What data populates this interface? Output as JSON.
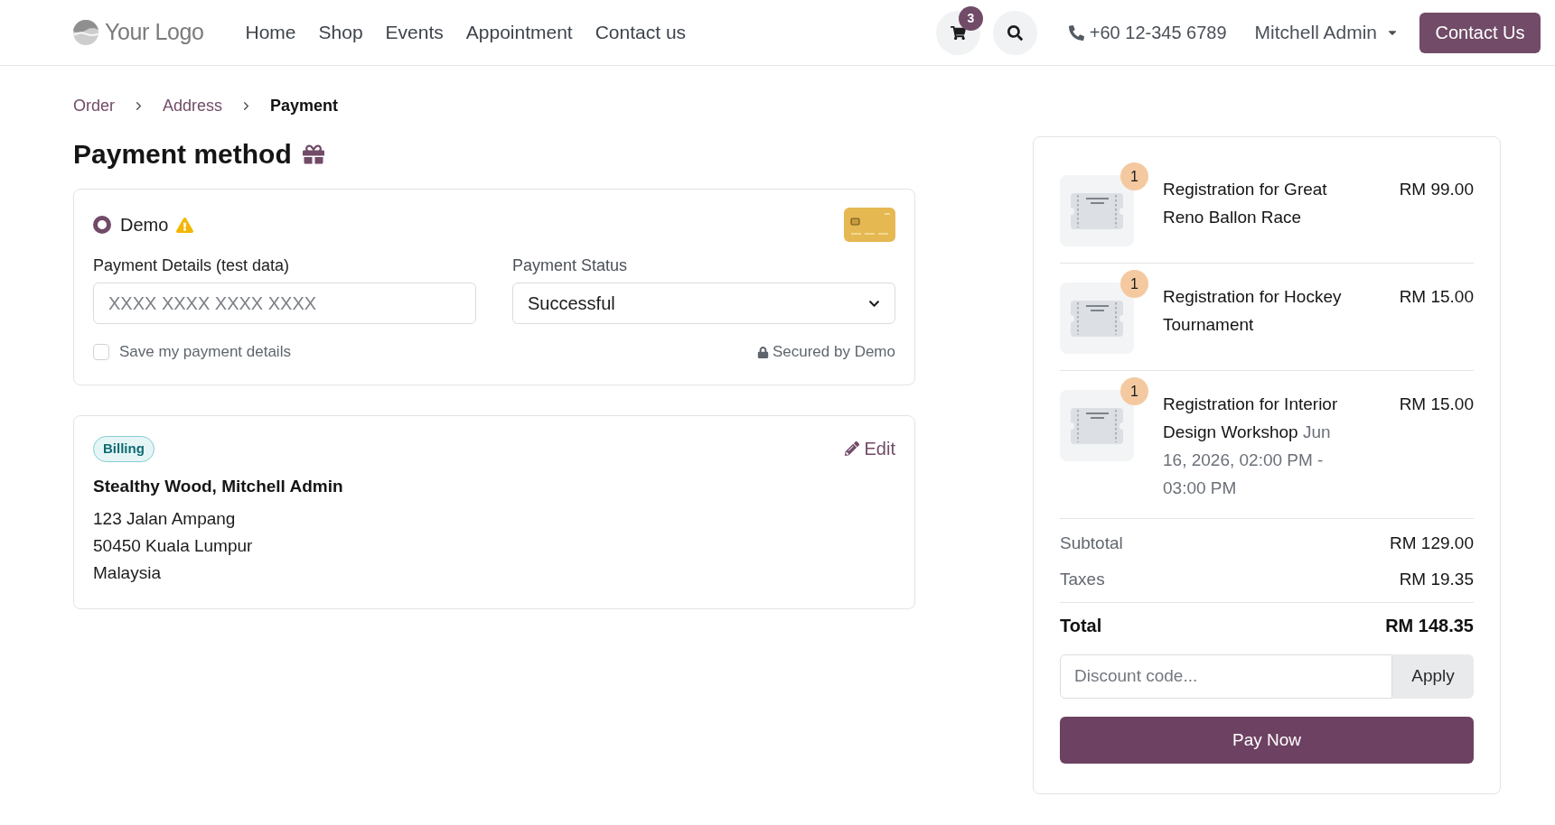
{
  "header": {
    "logo": "Your Logo",
    "nav": [
      "Home",
      "Shop",
      "Events",
      "Appointment",
      "Contact us"
    ],
    "cart_count": "3",
    "phone": "+60 12-345 6789",
    "user": "Mitchell Admin",
    "contact_button": "Contact Us"
  },
  "breadcrumb": [
    {
      "label": "Order",
      "current": false
    },
    {
      "label": "Address",
      "current": false
    },
    {
      "label": "Payment",
      "current": true
    }
  ],
  "payment": {
    "title": "Payment method",
    "methods": [
      {
        "name": "Demo",
        "selected": true
      }
    ],
    "card_details": {
      "label": "Payment Details (test data)",
      "placeholder": "XXXX XXXX XXXX XXXX"
    },
    "status": {
      "label": "Payment Status",
      "value": "Successful"
    },
    "save_details": {
      "label": "Save my payment details",
      "checked": false
    },
    "secured_note": "Secured by Demo"
  },
  "billing": {
    "badge": "Billing",
    "edit": "Edit",
    "name": "Stealthy Wood, Mitchell Admin",
    "address_lines": [
      "123 Jalan Ampang",
      "50450 Kuala Lumpur",
      "Malaysia"
    ]
  },
  "order_summary": {
    "items": [
      {
        "quantity": "1",
        "name": "Registration for Great Reno Ballon Race",
        "price": "RM 99.00"
      },
      {
        "quantity": "1",
        "name": "Registration for Hockey Tournament",
        "price": "RM 15.00"
      },
      {
        "quantity": "1",
        "name": "Registration for Interior Design Workshop",
        "schedule": "Jun 16, 2026, 02:00 PM - 03:00 PM",
        "price": "RM 15.00"
      }
    ],
    "subtotal": {
      "label": "Subtotal",
      "value": "RM 129.00"
    },
    "taxes": {
      "label": "Taxes",
      "value": "RM 19.35"
    },
    "total": {
      "label": "Total",
      "value": "RM 148.35"
    },
    "discount": {
      "placeholder": "Discount code...",
      "button": "Apply"
    },
    "pay_button": "Pay Now"
  }
}
